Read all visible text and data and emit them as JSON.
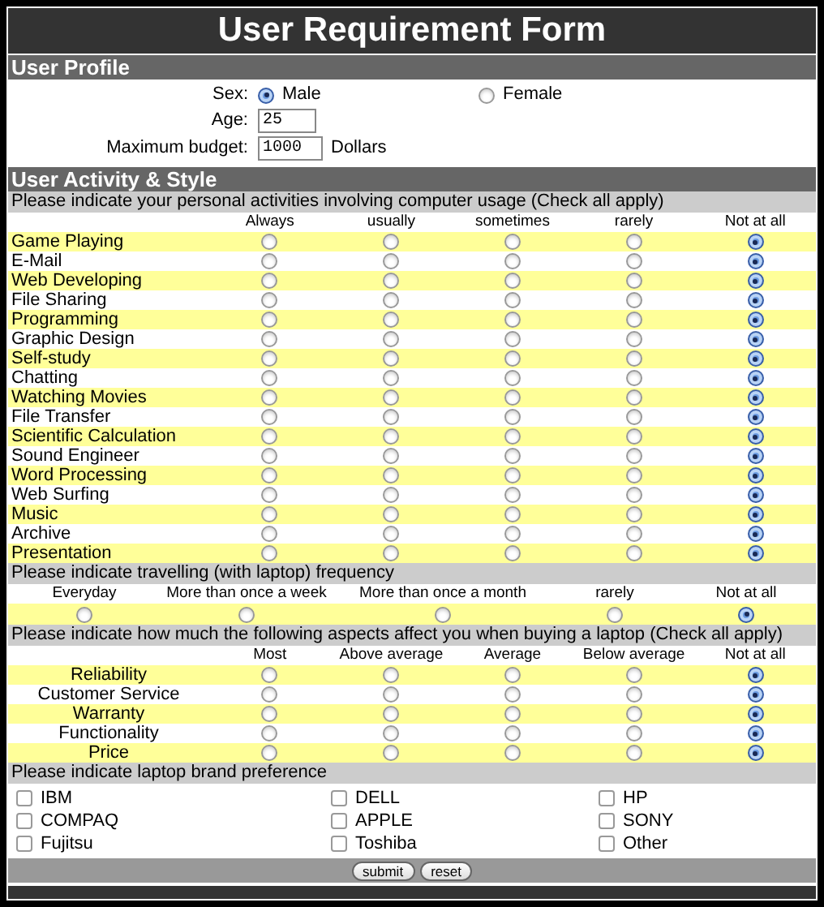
{
  "title": "User Requirement Form",
  "profile": {
    "heading": "User Profile",
    "sex": {
      "label": "Sex:",
      "options": [
        {
          "label": "Male",
          "selected": true
        },
        {
          "label": "Female",
          "selected": false
        }
      ]
    },
    "age": {
      "label": "Age:",
      "value": "25"
    },
    "budget": {
      "label": "Maximum budget:",
      "value": "1000",
      "unit": "Dollars"
    }
  },
  "activity": {
    "heading": "User Activity & Style",
    "usage": {
      "question": "Please indicate your personal activities involving computer usage (Check all apply)",
      "columns": [
        "Always",
        "usually",
        "sometimes",
        "rarely",
        "Not at all"
      ],
      "rows": [
        {
          "label": "Game Playing",
          "selected": [
            false,
            false,
            false,
            false,
            true
          ]
        },
        {
          "label": "E-Mail",
          "selected": [
            false,
            false,
            false,
            false,
            true
          ]
        },
        {
          "label": "Web Developing",
          "selected": [
            false,
            false,
            false,
            false,
            true
          ]
        },
        {
          "label": "File Sharing",
          "selected": [
            false,
            false,
            false,
            false,
            true
          ]
        },
        {
          "label": "Programming",
          "selected": [
            false,
            false,
            false,
            false,
            true
          ]
        },
        {
          "label": "Graphic Design",
          "selected": [
            false,
            false,
            false,
            false,
            true
          ]
        },
        {
          "label": "Self-study",
          "selected": [
            false,
            false,
            false,
            false,
            true
          ]
        },
        {
          "label": "Chatting",
          "selected": [
            false,
            false,
            false,
            false,
            true
          ]
        },
        {
          "label": "Watching Movies",
          "selected": [
            false,
            false,
            false,
            false,
            true
          ]
        },
        {
          "label": "File Transfer",
          "selected": [
            false,
            false,
            false,
            false,
            true
          ]
        },
        {
          "label": "Scientific Calculation",
          "selected": [
            false,
            false,
            false,
            false,
            true
          ]
        },
        {
          "label": "Sound Engineer",
          "selected": [
            false,
            false,
            false,
            false,
            true
          ]
        },
        {
          "label": "Word Processing",
          "selected": [
            false,
            false,
            false,
            false,
            true
          ]
        },
        {
          "label": "Web Surfing",
          "selected": [
            false,
            false,
            false,
            false,
            true
          ]
        },
        {
          "label": "Music",
          "selected": [
            false,
            false,
            false,
            false,
            true
          ]
        },
        {
          "label": "Archive",
          "selected": [
            false,
            false,
            false,
            false,
            true
          ]
        },
        {
          "label": "Presentation",
          "selected": [
            false,
            false,
            false,
            false,
            true
          ]
        }
      ]
    },
    "travel": {
      "question": "Please indicate travelling (with laptop) frequency",
      "options": [
        {
          "label": "Everyday",
          "selected": false
        },
        {
          "label": "More than once a week",
          "selected": false
        },
        {
          "label": "More than once a month",
          "selected": false
        },
        {
          "label": "rarely",
          "selected": false
        },
        {
          "label": "Not at all",
          "selected": true
        }
      ]
    },
    "aspects": {
      "question": "Please indicate how much the following aspects affect you when buying a laptop (Check all apply)",
      "columns": [
        "Most",
        "Above average",
        "Average",
        "Below average",
        "Not at all"
      ],
      "rows": [
        {
          "label": "Reliability",
          "selected": [
            false,
            false,
            false,
            false,
            true
          ]
        },
        {
          "label": "Customer Service",
          "selected": [
            false,
            false,
            false,
            false,
            true
          ]
        },
        {
          "label": "Warranty",
          "selected": [
            false,
            false,
            false,
            false,
            true
          ]
        },
        {
          "label": "Functionality",
          "selected": [
            false,
            false,
            false,
            false,
            true
          ]
        },
        {
          "label": "Price",
          "selected": [
            false,
            false,
            false,
            false,
            true
          ]
        }
      ]
    },
    "brands": {
      "question": "Please indicate laptop brand preference",
      "options": [
        {
          "label": "IBM",
          "checked": false
        },
        {
          "label": "DELL",
          "checked": false
        },
        {
          "label": "HP",
          "checked": false
        },
        {
          "label": "COMPAQ",
          "checked": false
        },
        {
          "label": "APPLE",
          "checked": false
        },
        {
          "label": "SONY",
          "checked": false
        },
        {
          "label": "Fujitsu",
          "checked": false
        },
        {
          "label": "Toshiba",
          "checked": false
        },
        {
          "label": "Other",
          "checked": false
        }
      ]
    }
  },
  "buttons": [
    "submit",
    "reset"
  ]
}
